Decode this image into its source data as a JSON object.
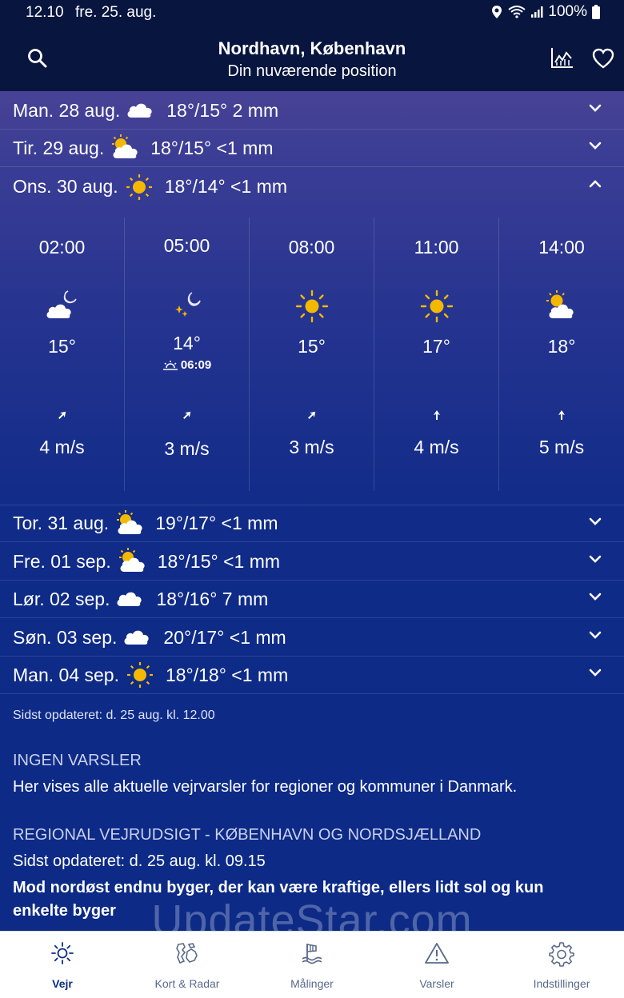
{
  "status": {
    "time": "12.10",
    "date": "fre. 25. aug.",
    "battery": "100%"
  },
  "header": {
    "title": "Nordhavn, København",
    "subtitle": "Din nuværende position"
  },
  "days_top": [
    {
      "label": "Man. 28 aug.",
      "icon": "cloud-icon",
      "temps": "18°/15° 2 mm"
    },
    {
      "label": "Tir. 29 aug.",
      "icon": "sun-cloud-icon",
      "temps": "18°/15° <1 mm"
    },
    {
      "label": "Ons. 30 aug.",
      "icon": "sun-icon",
      "temps": "18°/14° <1 mm"
    }
  ],
  "hourly": [
    {
      "time": "02:00",
      "icon": "moon-cloud-icon",
      "temp": "15°",
      "wind": "4 m/s",
      "dir": "north-east"
    },
    {
      "time": "05:00",
      "icon": "moon-stars-icon",
      "temp": "14°",
      "sunrise": "06:09",
      "wind": "3 m/s",
      "dir": "north-east"
    },
    {
      "time": "08:00",
      "icon": "sun-icon",
      "temp": "15°",
      "wind": "3 m/s",
      "dir": "north-east"
    },
    {
      "time": "11:00",
      "icon": "sun-icon",
      "temp": "17°",
      "wind": "4 m/s",
      "dir": "north"
    },
    {
      "time": "14:00",
      "icon": "sun-cloud-icon",
      "temp": "18°",
      "wind": "5 m/s",
      "dir": "north"
    }
  ],
  "days_bottom": [
    {
      "label": "Tor. 31 aug.",
      "icon": "sun-cloud-icon",
      "temps": "19°/17° <1 mm"
    },
    {
      "label": "Fre. 01 sep.",
      "icon": "sun-cloud-icon",
      "temps": "18°/15° <1 mm"
    },
    {
      "label": "Lør. 02 sep.",
      "icon": "cloud-icon",
      "temps": "18°/16° 7 mm"
    },
    {
      "label": "Søn. 03 sep.",
      "icon": "cloud-icon",
      "temps": "20°/17° <1 mm"
    },
    {
      "label": "Man. 04 sep.",
      "icon": "sun-icon",
      "temps": "18°/18° <1 mm"
    }
  ],
  "updated": "Sidst opdateret: d. 25 aug. kl. 12.00",
  "warnings": {
    "heading": "INGEN VARSLER",
    "text": "Her vises alle aktuelle vejrvarsler for regioner og kommuner i Danmark."
  },
  "regional": {
    "heading": "REGIONAL VEJRUDSIGT - KØBENHAVN OG NORDSJÆLLAND",
    "updated": "Sidst opdateret: d. 25 aug. kl. 09.15",
    "line1": "Mod nordøst endnu byger, der kan være kraftige, ellers lidt sol og kun",
    "line2": "enkelte byger"
  },
  "watermark": "UpdateStar.com",
  "nav": [
    {
      "label": "Vejr",
      "icon": "sun-icon"
    },
    {
      "label": "Kort & Radar",
      "icon": "map-icon"
    },
    {
      "label": "Målinger",
      "icon": "measurement-icon"
    },
    {
      "label": "Varsler",
      "icon": "warning-icon"
    },
    {
      "label": "Indstillinger",
      "icon": "gear-icon"
    }
  ],
  "colors": {
    "header_bg": "#07153f",
    "accent_sun": "#f5b800",
    "panel_bg": "#0b2a86"
  }
}
